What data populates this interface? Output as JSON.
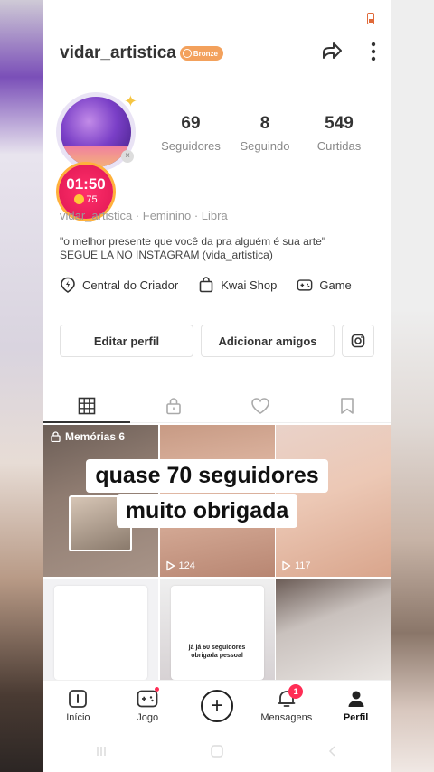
{
  "profile": {
    "username": "vidar_artistica",
    "badge_label": "Bronze",
    "followers_count": "69",
    "followers_label": "Seguidores",
    "following_count": "8",
    "following_label": "Seguindo",
    "likes_count": "549",
    "likes_label": "Curtidas",
    "info_line": "vidar_artistica · Feminino · Libra",
    "bio_line1": "\"o melhor presente que você da pra alguém é sua arte\"",
    "bio_line2": "SEGUE LA NO INSTAGRAM (vida_artistica)"
  },
  "live": {
    "timer": "01:50",
    "coins": "75"
  },
  "tools": [
    {
      "label": "Central do Criador",
      "icon": "creator-center-icon"
    },
    {
      "label": "Kwai Shop",
      "icon": "shopping-bag-icon"
    },
    {
      "label": "Game",
      "icon": "gamepad-icon"
    }
  ],
  "actions": {
    "edit_label": "Editar perfil",
    "add_friends_label": "Adicionar amigos"
  },
  "tabs": [
    "grid-icon",
    "lock-icon",
    "heart-icon",
    "bookmark-icon"
  ],
  "grid": {
    "memories_label": "Memórias 6",
    "cell2_plays": "124",
    "cell3_plays": "117",
    "cell5_text": "já já 60 seguidores obrigada pessoal"
  },
  "caption": {
    "line1": "quase 70 seguidores",
    "line2": "muito obrigada"
  },
  "nav": {
    "home": "Início",
    "game": "Jogo",
    "messages": "Mensagens",
    "messages_badge": "1",
    "profile": "Perfil"
  },
  "colors": {
    "badge": "#f3a15c",
    "live": "#e81e5a",
    "notification": "#ff2d55"
  }
}
